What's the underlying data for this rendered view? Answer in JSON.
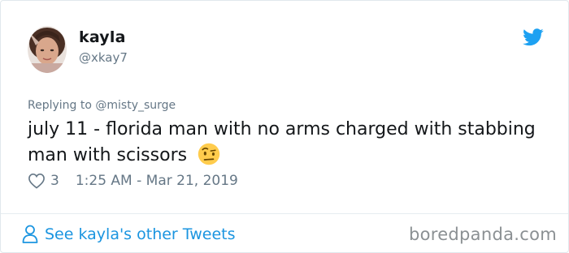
{
  "author": {
    "name": "kayla",
    "handle": "@xkay7",
    "avatar_icon": "profile-photo"
  },
  "brand": {
    "icon": "twitter-bird-icon",
    "color": "#1da1f2"
  },
  "tweet": {
    "replying_prefix": "Replying to ",
    "replying_to": "@misty_surge",
    "text": "july 11 - florida man with no arms charged with stabbing man with scissors",
    "emoji": "face-with-raised-eyebrow",
    "likes": "3",
    "timestamp": "1:25 AM - Mar 21, 2019"
  },
  "footer": {
    "link_label": "See kayla's other Tweets",
    "link_color": "#1b95e0",
    "watermark": "boredpanda.com"
  }
}
